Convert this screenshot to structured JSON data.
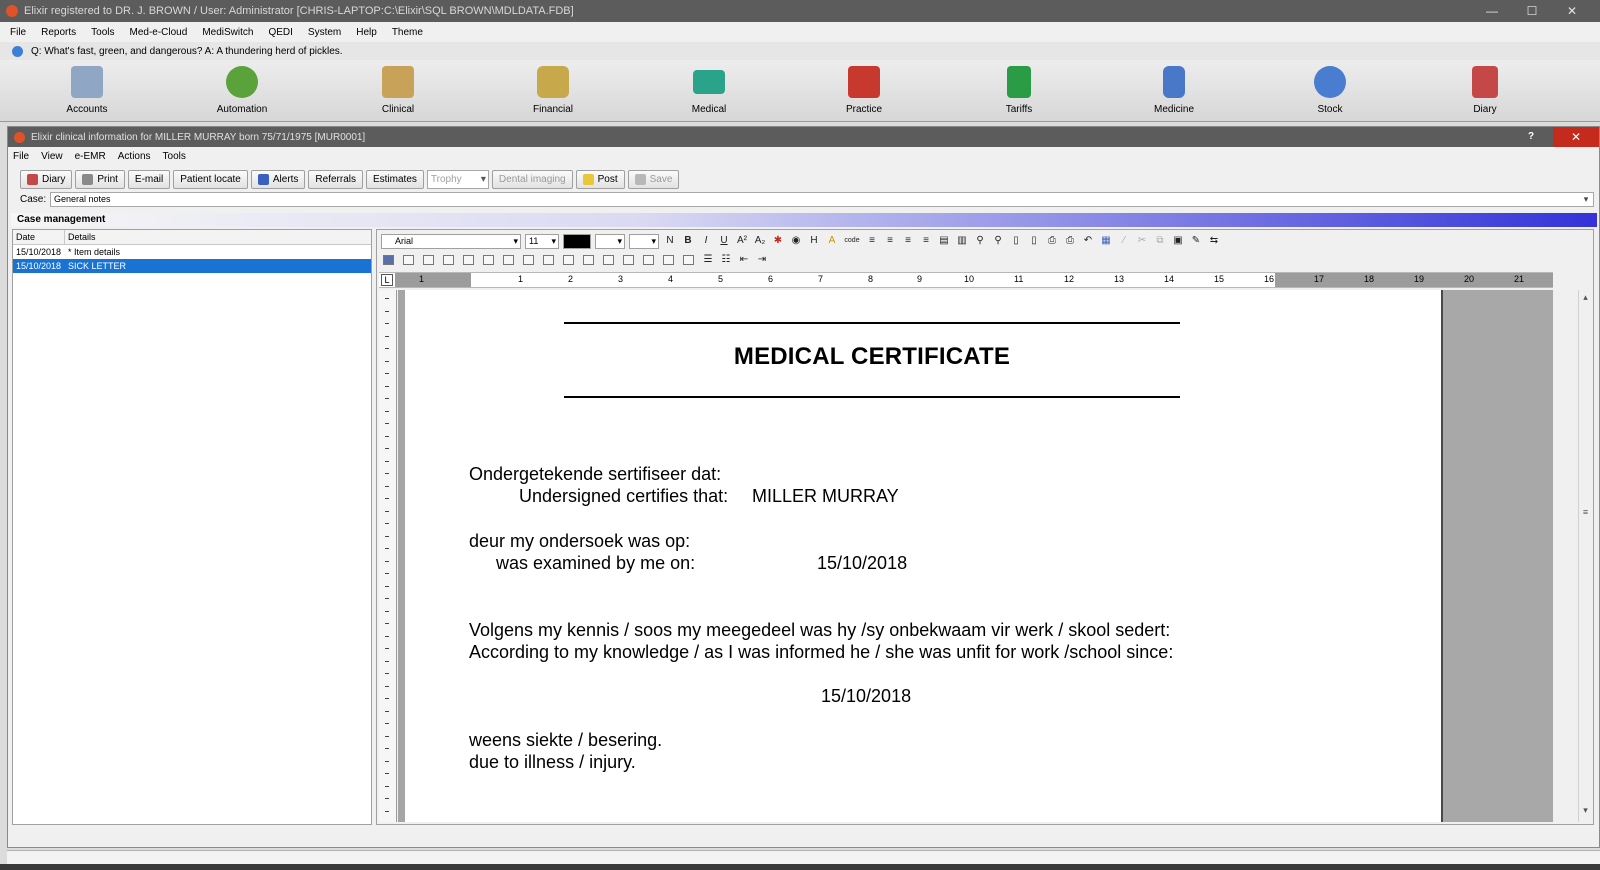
{
  "window": {
    "title": "Elixir registered to DR. J. BROWN / User: Administrator [CHRIS-LAPTOP:C:\\Elixir\\SQL BROWN\\MDLDATA.FDB]",
    "controls": [
      "—",
      "☐",
      "✕"
    ]
  },
  "main_menu": [
    "File",
    "Reports",
    "Tools",
    "Med-e-Cloud",
    "MediSwitch",
    "QEDI",
    "System",
    "Help",
    "Theme"
  ],
  "joke": "Q: What's fast, green, and dangerous? A: A thundering herd of pickles.",
  "big_toolbar": [
    {
      "label": "Accounts",
      "color": "#8fa6c4"
    },
    {
      "label": "Automation",
      "color": "#5aa23a"
    },
    {
      "label": "Clinical",
      "color": "#c9a25a"
    },
    {
      "label": "Financial",
      "color": "#c7a84a"
    },
    {
      "label": "Medical",
      "color": "#2aa38a"
    },
    {
      "label": "Practice",
      "color": "#c7382f"
    },
    {
      "label": "Tariffs",
      "color": "#2b9c46"
    },
    {
      "label": "Medicine",
      "color": "#4a78c8"
    },
    {
      "label": "Stock",
      "color": "#4a7ccf"
    },
    {
      "label": "Diary",
      "color": "#c54848"
    }
  ],
  "child_window": {
    "title": "Elixir clinical information for MILLER MURRAY born 75/71/1975 [MUR0001]",
    "help": "?",
    "close": "✕",
    "menu": [
      "File",
      "View",
      "e-EMR",
      "Actions",
      "Tools"
    ],
    "toolbar": {
      "diary": "Diary",
      "print": "Print",
      "email": "E-mail",
      "patient_locate": "Patient locate",
      "alerts": "Alerts",
      "referrals": "Referrals",
      "estimates": "Estimates",
      "trophy": "Trophy",
      "dental_imaging": "Dental imaging",
      "post": "Post",
      "save": "Save"
    },
    "case_label": "Case:",
    "case_value": "General notes",
    "case_management": "Case management",
    "case_list": {
      "headers": [
        "Date",
        "Details"
      ],
      "rows": [
        {
          "date": "15/10/2018",
          "details": "* Item details",
          "selected": false
        },
        {
          "date": "15/10/2018",
          "details": "SICK LETTER",
          "selected": true
        }
      ]
    },
    "editor": {
      "font_name": "Arial",
      "font_size": "11",
      "ruler_numbers": [
        "1",
        "1",
        "2",
        "3",
        "4",
        "5",
        "6",
        "7",
        "8",
        "9",
        "10",
        "11",
        "12",
        "13",
        "14",
        "15",
        "16",
        "17",
        "18",
        "19",
        "20",
        "21"
      ],
      "document": {
        "heading": "MEDICAL CERTIFICATE",
        "line1": "Ondergetekende sertifiseer dat:",
        "line2_label": "Undersigned certifies that:",
        "patient": "MILLER MURRAY",
        "line3": "deur my ondersoek was op:",
        "line4_label": "was examined by me on:",
        "exam_date": "15/10/2018",
        "line5": "Volgens my kennis / soos my meegedeel was hy /sy onbekwaam vir werk / skool sedert:",
        "line6": "According to my knowledge / as I was informed he / she was unfit for work /school since:",
        "since_date": "15/10/2018",
        "line7": "weens siekte / besering.",
        "line8": "due to illness / injury."
      }
    }
  }
}
